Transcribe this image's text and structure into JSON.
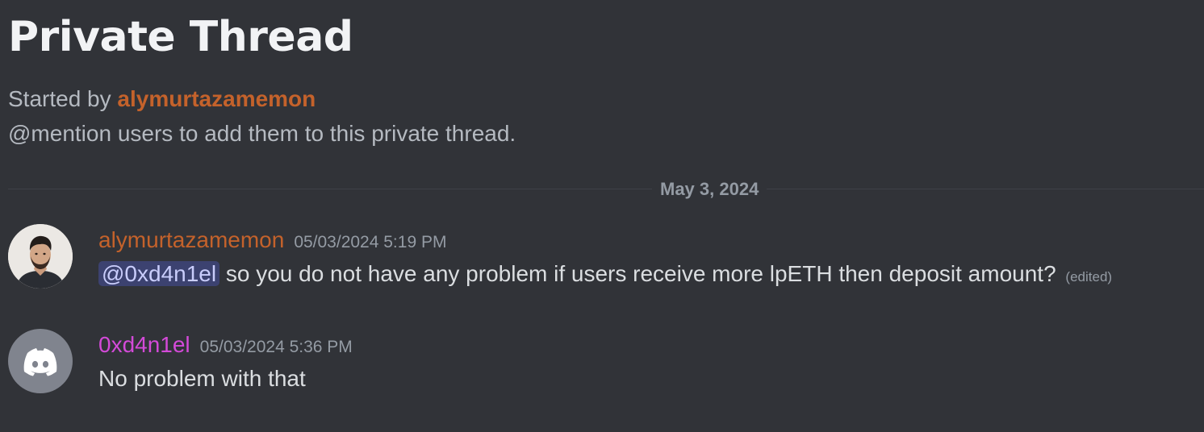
{
  "thread": {
    "title": "Private Thread",
    "started_by_prefix": "Started by ",
    "started_by_user": "alymurtazamemon",
    "hint": "@mention users to add them to this private thread."
  },
  "divider": {
    "date": "May 3, 2024"
  },
  "messages": [
    {
      "avatar": "user-photo-avatar",
      "username": "alymurtazamemon",
      "username_color": "#c4622b",
      "timestamp": "05/03/2024 5:19 PM",
      "mention": "@0xd4n1el",
      "text": " so you do not have any problem if users receive more lpETH then deposit amount?",
      "edited": "(edited)"
    },
    {
      "avatar": "discord-logo-avatar",
      "username": "0xd4n1el",
      "username_color": "#d34ad8",
      "timestamp": "05/03/2024 5:36 PM",
      "text": "No problem with that"
    }
  ]
}
